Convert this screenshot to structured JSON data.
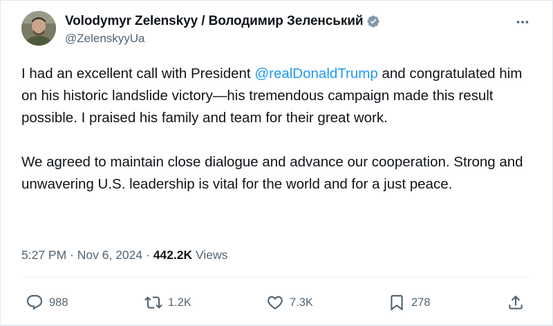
{
  "author": {
    "display_name": "Volodymyr Zelenskyy / Володимир Зеленський",
    "handle": "@ZelenskyyUa",
    "verified": true,
    "verified_color": "#829aab"
  },
  "tweet": {
    "p1_before": "I had an excellent call with President ",
    "p1_mention": "@realDonaldTrump",
    "p1_after": " and congratulated him on his historic landslide victory—his tremendous campaign made this result possible. I praised his family and team for their great work.",
    "p2": "We agreed to maintain close dialogue and advance our cooperation. Strong and unwavering U.S. leadership is vital for the world and for a just peace.",
    "mention_color": "#1d9bf0"
  },
  "meta": {
    "time": "5:27 PM",
    "separator": " · ",
    "date": "Nov 6, 2024",
    "separator2": " · ",
    "views_count": "442.2K",
    "views_label": " Views"
  },
  "actions": {
    "reply": {
      "icon": "reply-icon",
      "count": "988"
    },
    "retweet": {
      "icon": "retweet-icon",
      "count": "1.2K"
    },
    "like": {
      "icon": "heart-icon",
      "count": "7.3K"
    },
    "bookmark": {
      "icon": "bookmark-icon",
      "count": "278"
    },
    "share": {
      "icon": "share-icon"
    }
  },
  "colors": {
    "text_primary": "#0f1419",
    "text_secondary": "#536471"
  }
}
